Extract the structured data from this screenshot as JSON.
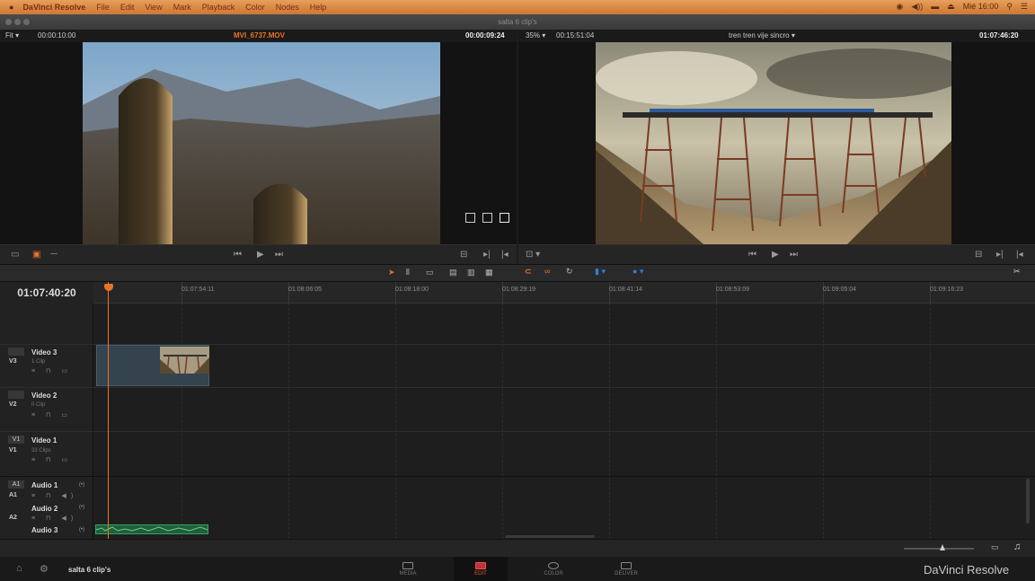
{
  "menubar": {
    "apple": "",
    "app_name": "DaVinci Resolve",
    "items": [
      "File",
      "Edit",
      "View",
      "Mark",
      "Playback",
      "Color",
      "Nodes",
      "Help"
    ],
    "clock": "Mié 16:00"
  },
  "window": {
    "title": "salta 6 clip's"
  },
  "source_viewer": {
    "zoom": "Fit",
    "duration_tc": "00:00:10:00",
    "clip_name": "MVI_6737.MOV",
    "current_tc": "00:00:09:24"
  },
  "timeline_viewer": {
    "zoom": "35%",
    "duration_tc": "00:15:51:04",
    "timeline_name": "tren tren vije sincro",
    "current_tc": "01:07:46:20"
  },
  "timeline": {
    "current_tc": "01:07:40:20",
    "ruler": [
      "01:07:54:11",
      "01:08:06:05",
      "01:08:18:00",
      "01:08:29:19",
      "01:08:41:14",
      "01:08:53:09",
      "01:09:05:04",
      "01:09:16:23"
    ],
    "video_tracks": [
      {
        "id": "V3",
        "name": "Video 3",
        "clips": "1 Clip"
      },
      {
        "id": "V2",
        "name": "Video 2",
        "clips": "0 Clip"
      },
      {
        "id": "V1",
        "name": "Video 1",
        "clips": "33 Clips",
        "box": "V1"
      }
    ],
    "audio_tracks": [
      {
        "id": "A1",
        "name": "Audio 1",
        "box": "A1",
        "stereo": "(•)"
      },
      {
        "id": "A2",
        "name": "Audio 2",
        "stereo": "(•)"
      },
      {
        "id": "",
        "name": "Audio 3",
        "stereo": "(•)"
      }
    ]
  },
  "footer": {
    "project_name": "salta 6 clip's",
    "pages": [
      "MEDIA",
      "EDIT",
      "COLOR",
      "DELIVER"
    ],
    "active_page": "EDIT",
    "brand": "DaVinci Resolve"
  },
  "colors": {
    "accent": "#e8732a",
    "active_page": "#e35a40",
    "clip_v3": "#3a4a55",
    "audio_clip": "#3aa15a",
    "playhead": "#e8732a"
  }
}
